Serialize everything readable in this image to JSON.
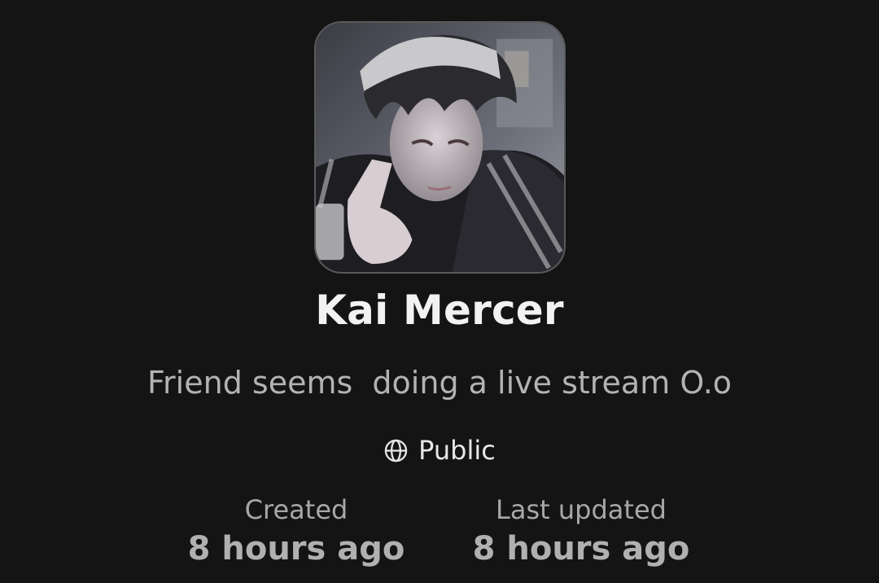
{
  "profile": {
    "name": "Kai Mercer",
    "tagline": "Friend seems  doing a live stream O.o",
    "avatar_icon": "character-portrait"
  },
  "visibility": {
    "icon": "globe-icon",
    "label": "Public"
  },
  "meta": {
    "created_label": "Created",
    "created_value": "8 hours ago",
    "updated_label": "Last updated",
    "updated_value": "8 hours ago"
  },
  "colors": {
    "background": "#141414",
    "name_text": "#f2f2f2",
    "secondary_text": "#b3b3b3"
  }
}
